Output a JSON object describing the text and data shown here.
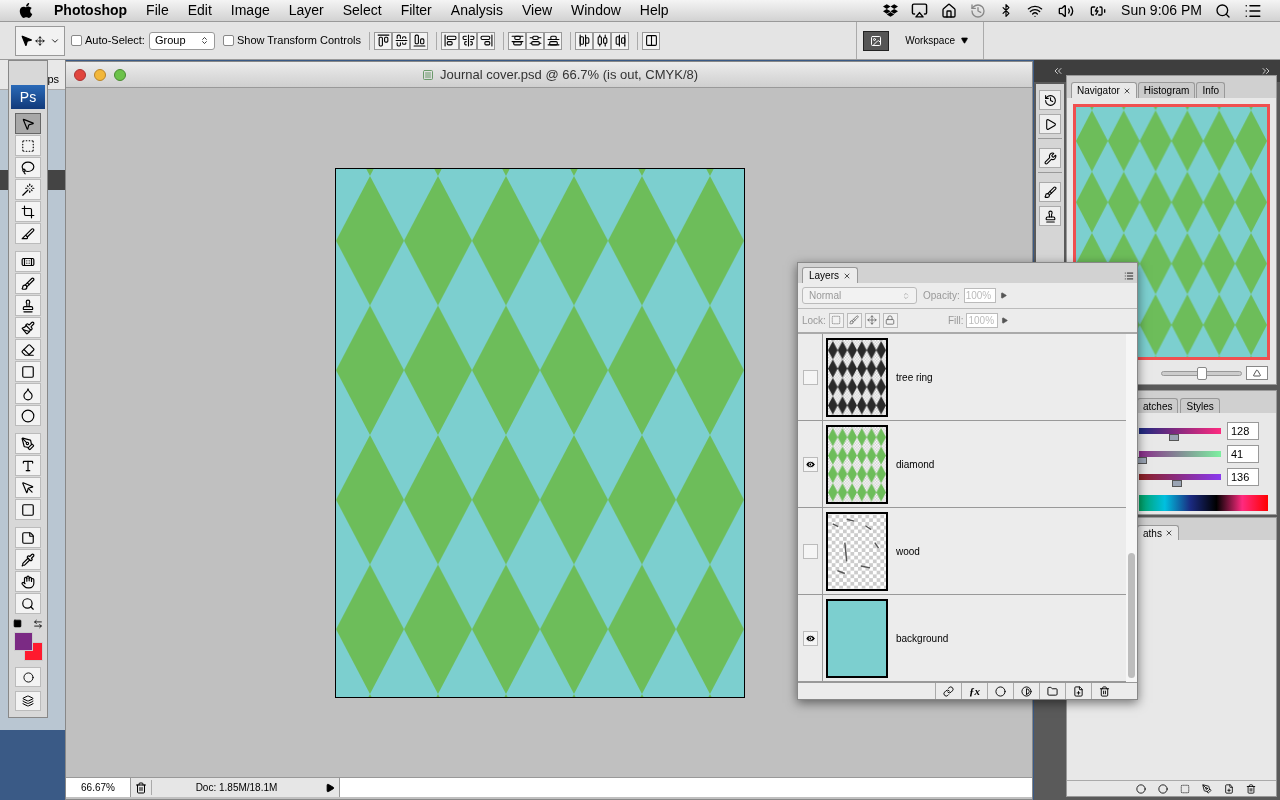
{
  "menu_bar": {
    "app": "Photoshop",
    "menus": [
      "File",
      "Edit",
      "Image",
      "Layer",
      "Select",
      "Filter",
      "Analysis",
      "View",
      "Window",
      "Help"
    ],
    "clock": "Sun 9:06 PM"
  },
  "options_bar": {
    "auto_select": {
      "label": "Auto-Select:",
      "checked": false
    },
    "auto_select_target": "Group",
    "show_transform": {
      "label": "Show Transform Controls",
      "checked": false
    },
    "workspace": "Workspace"
  },
  "background_window": {
    "title_fragment": "ps"
  },
  "toolbox": {
    "logo": "Ps",
    "swatches": [
      {
        "color": "#7b2a84"
      },
      {
        "color": "#ff1a2e"
      }
    ],
    "tools": [
      {
        "selected": true
      },
      {
        "selected": false
      },
      {
        "selected": false
      },
      {
        "selected": false
      },
      {
        "selected": false
      },
      {
        "selected": false
      },
      {
        "selected": false
      },
      {
        "selected": false
      },
      {
        "selected": false
      },
      {
        "selected": false
      },
      {
        "selected": false
      },
      {
        "selected": false
      },
      {
        "selected": false
      },
      {
        "selected": false
      },
      {
        "selected": false
      },
      {
        "selected": false
      },
      {
        "selected": false
      },
      {
        "selected": false
      },
      {
        "selected": false
      },
      {
        "selected": false
      },
      {
        "selected": false
      },
      {
        "selected": false
      }
    ]
  },
  "document": {
    "title": "Journal cover.psd @ 66.7% (is out, CMYK/8)",
    "zoom": "66.67%",
    "doc_size": "Doc: 1.85M/18.1M"
  },
  "navigator": {
    "tabs": [
      {
        "label": "Navigator",
        "selected": true
      },
      {
        "label": "Histogram",
        "selected": false
      },
      {
        "label": "Info",
        "selected": false
      }
    ],
    "zoom_slider": {
      "level": 0.5
    }
  },
  "color_panel": {
    "tabs": [
      {
        "label": "atches",
        "selected": false
      },
      {
        "label": "Styles",
        "selected": false
      }
    ],
    "channels": [
      {
        "value": "128",
        "level": 0.43
      },
      {
        "value": "41",
        "level": 0.04
      },
      {
        "value": "136",
        "level": 0.46
      }
    ]
  },
  "paths_panel": {
    "tab": "aths"
  },
  "layers_panel": {
    "tab": "Layers",
    "effects_label": "ƒx",
    "blend_mode": "Normal",
    "opacity_label": "Opacity:",
    "opacity": "100%",
    "lock_label": "Lock:",
    "fill_label": "Fill:",
    "fill": "100%",
    "layers": [
      {
        "name": "tree ring",
        "visible": false,
        "kind": "texture"
      },
      {
        "name": "diamond",
        "visible": true,
        "kind": "diamonds"
      },
      {
        "name": "wood",
        "visible": false,
        "kind": "speckle"
      },
      {
        "name": "background",
        "visible": true,
        "kind": "fill"
      }
    ]
  }
}
